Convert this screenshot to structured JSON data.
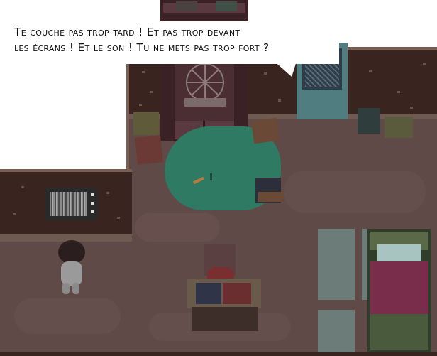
{
  "dialogue": {
    "line1": "Te couche pas trop tard ! Et pas trop devant",
    "line2": "les écrans ! Et le son ! Tu ne mets pas trop fort ?"
  },
  "colors": {
    "wall": "#3a241f",
    "floor": "#5f4a48",
    "rug": "#2e7a63",
    "door": "#4f7d80",
    "window_light": "#6f8e8a",
    "blanket": "#7a2d4a"
  }
}
